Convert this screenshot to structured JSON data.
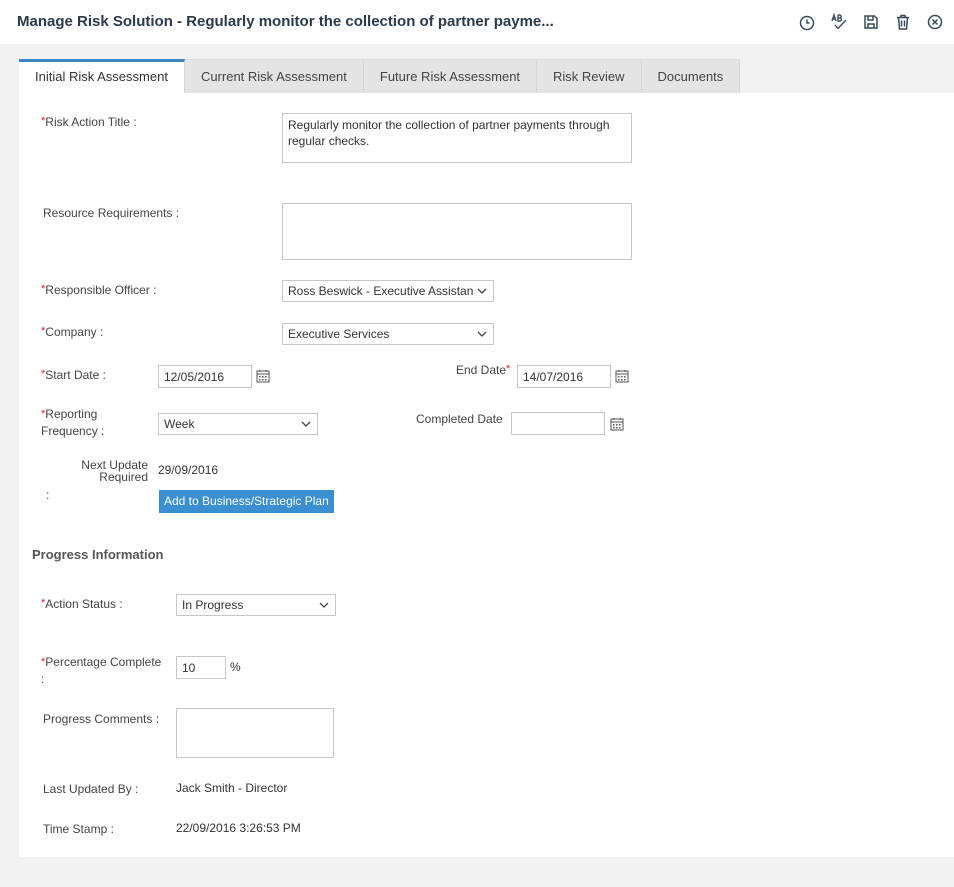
{
  "window": {
    "title": "Manage Risk Solution - Regularly monitor the collection of partner payme...",
    "toolbar": [
      {
        "icon": "history-icon"
      },
      {
        "icon": "spellcheck-icon"
      },
      {
        "icon": "save-icon"
      },
      {
        "icon": "delete-icon"
      },
      {
        "icon": "close-icon"
      }
    ]
  },
  "tabs": [
    {
      "label": "Initial Risk Assessment",
      "active": true
    },
    {
      "label": "Current Risk Assessment"
    },
    {
      "label": "Future Risk Assessment"
    },
    {
      "label": "Risk Review"
    },
    {
      "label": "Documents"
    }
  ],
  "form": {
    "risk_action_title": {
      "label": "Risk Action Title :",
      "value": "Regularly monitor the collection of  partner payments through regular checks."
    },
    "resource_requirements": {
      "label": "Resource Requirements :",
      "value": ""
    },
    "responsible_officer": {
      "label": "Responsible Officer :",
      "value": "Ross Beswick - Executive Assistan"
    },
    "company": {
      "label": "Company :",
      "value": "Executive Services"
    },
    "start_date": {
      "label": "Start Date :",
      "value": "12/05/2016"
    },
    "end_date": {
      "label": "End Date",
      "value": "14/07/2016"
    },
    "reporting_frequency": {
      "label_line1": "Reporting",
      "label_line2": "Frequency :",
      "value": "Week"
    },
    "completed_date": {
      "label": "Completed Date",
      "value": ""
    },
    "next_update": {
      "label_line1": "Next Update",
      "label_line2": "Required",
      "label_line3": ":",
      "value": "29/09/2016"
    },
    "add_plan_button": "Add to Business/Strategic Plan"
  },
  "progress": {
    "heading": "Progress Information",
    "action_status": {
      "label": "Action Status :",
      "value": "In Progress"
    },
    "percentage_complete": {
      "label_line1": "Percentage Complete",
      "label_line2": ":",
      "value": "10",
      "unit": "%"
    },
    "progress_comments": {
      "label": "Progress Comments :",
      "value": ""
    },
    "last_updated_by": {
      "label": "Last Updated By :",
      "value": "Jack Smith - Director"
    },
    "time_stamp": {
      "label": "Time Stamp :",
      "value": "22/09/2016 3:26:53 PM"
    }
  },
  "colors": {
    "accent": "#3a87c8",
    "button": "#3a8fd0",
    "required": "#d9262c"
  }
}
